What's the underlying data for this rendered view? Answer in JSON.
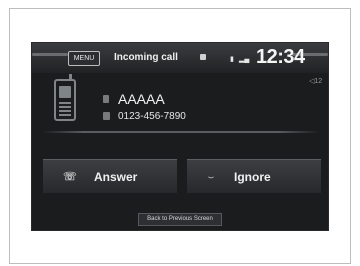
{
  "status_bar": {
    "menu_label": "MENU",
    "title": "Incoming call",
    "clock": "12:34"
  },
  "volume_indicator": "◁12",
  "caller": {
    "name": "AAAAA",
    "number": "0123-456-7890"
  },
  "buttons": {
    "answer_label": "Answer",
    "ignore_label": "Ignore",
    "back_label": "Back to Previous Screen"
  },
  "icons": {
    "phone": "phone-icon",
    "answer": "answer-icon",
    "ignore": "ignore-icon",
    "bluetooth": "bluetooth-icon",
    "battery": "battery-icon",
    "signal": "signal-icon"
  }
}
